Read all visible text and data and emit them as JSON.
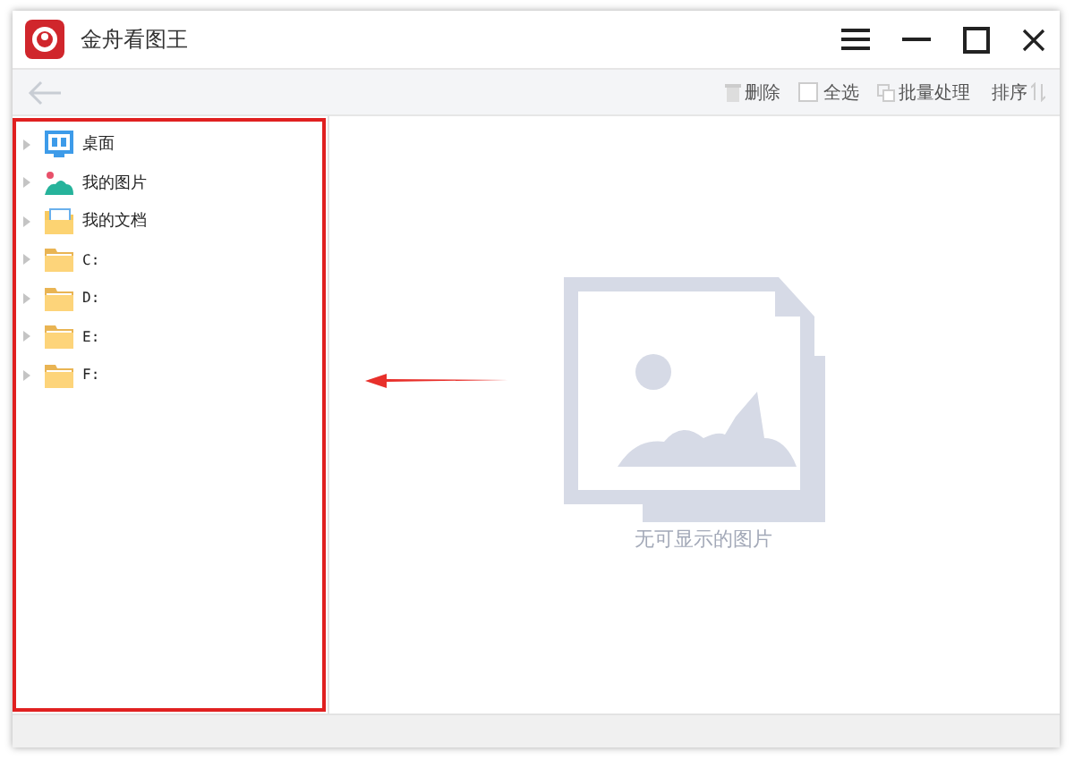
{
  "window": {
    "title": "金舟看图王"
  },
  "toolbar": {
    "delete": "删除",
    "select_all": {
      "label": "全选",
      "checked": false
    },
    "batch": "批量处理",
    "sort": "排序"
  },
  "sidebar": {
    "items": [
      {
        "label": "桌面",
        "kind": "desktop"
      },
      {
        "label": "我的图片",
        "kind": "pictures"
      },
      {
        "label": "我的文档",
        "kind": "documents"
      },
      {
        "label": "C:",
        "kind": "drive"
      },
      {
        "label": "D:",
        "kind": "drive"
      },
      {
        "label": "E:",
        "kind": "drive"
      },
      {
        "label": "F:",
        "kind": "drive"
      }
    ]
  },
  "viewer": {
    "empty_message": "无可显示的图片"
  }
}
